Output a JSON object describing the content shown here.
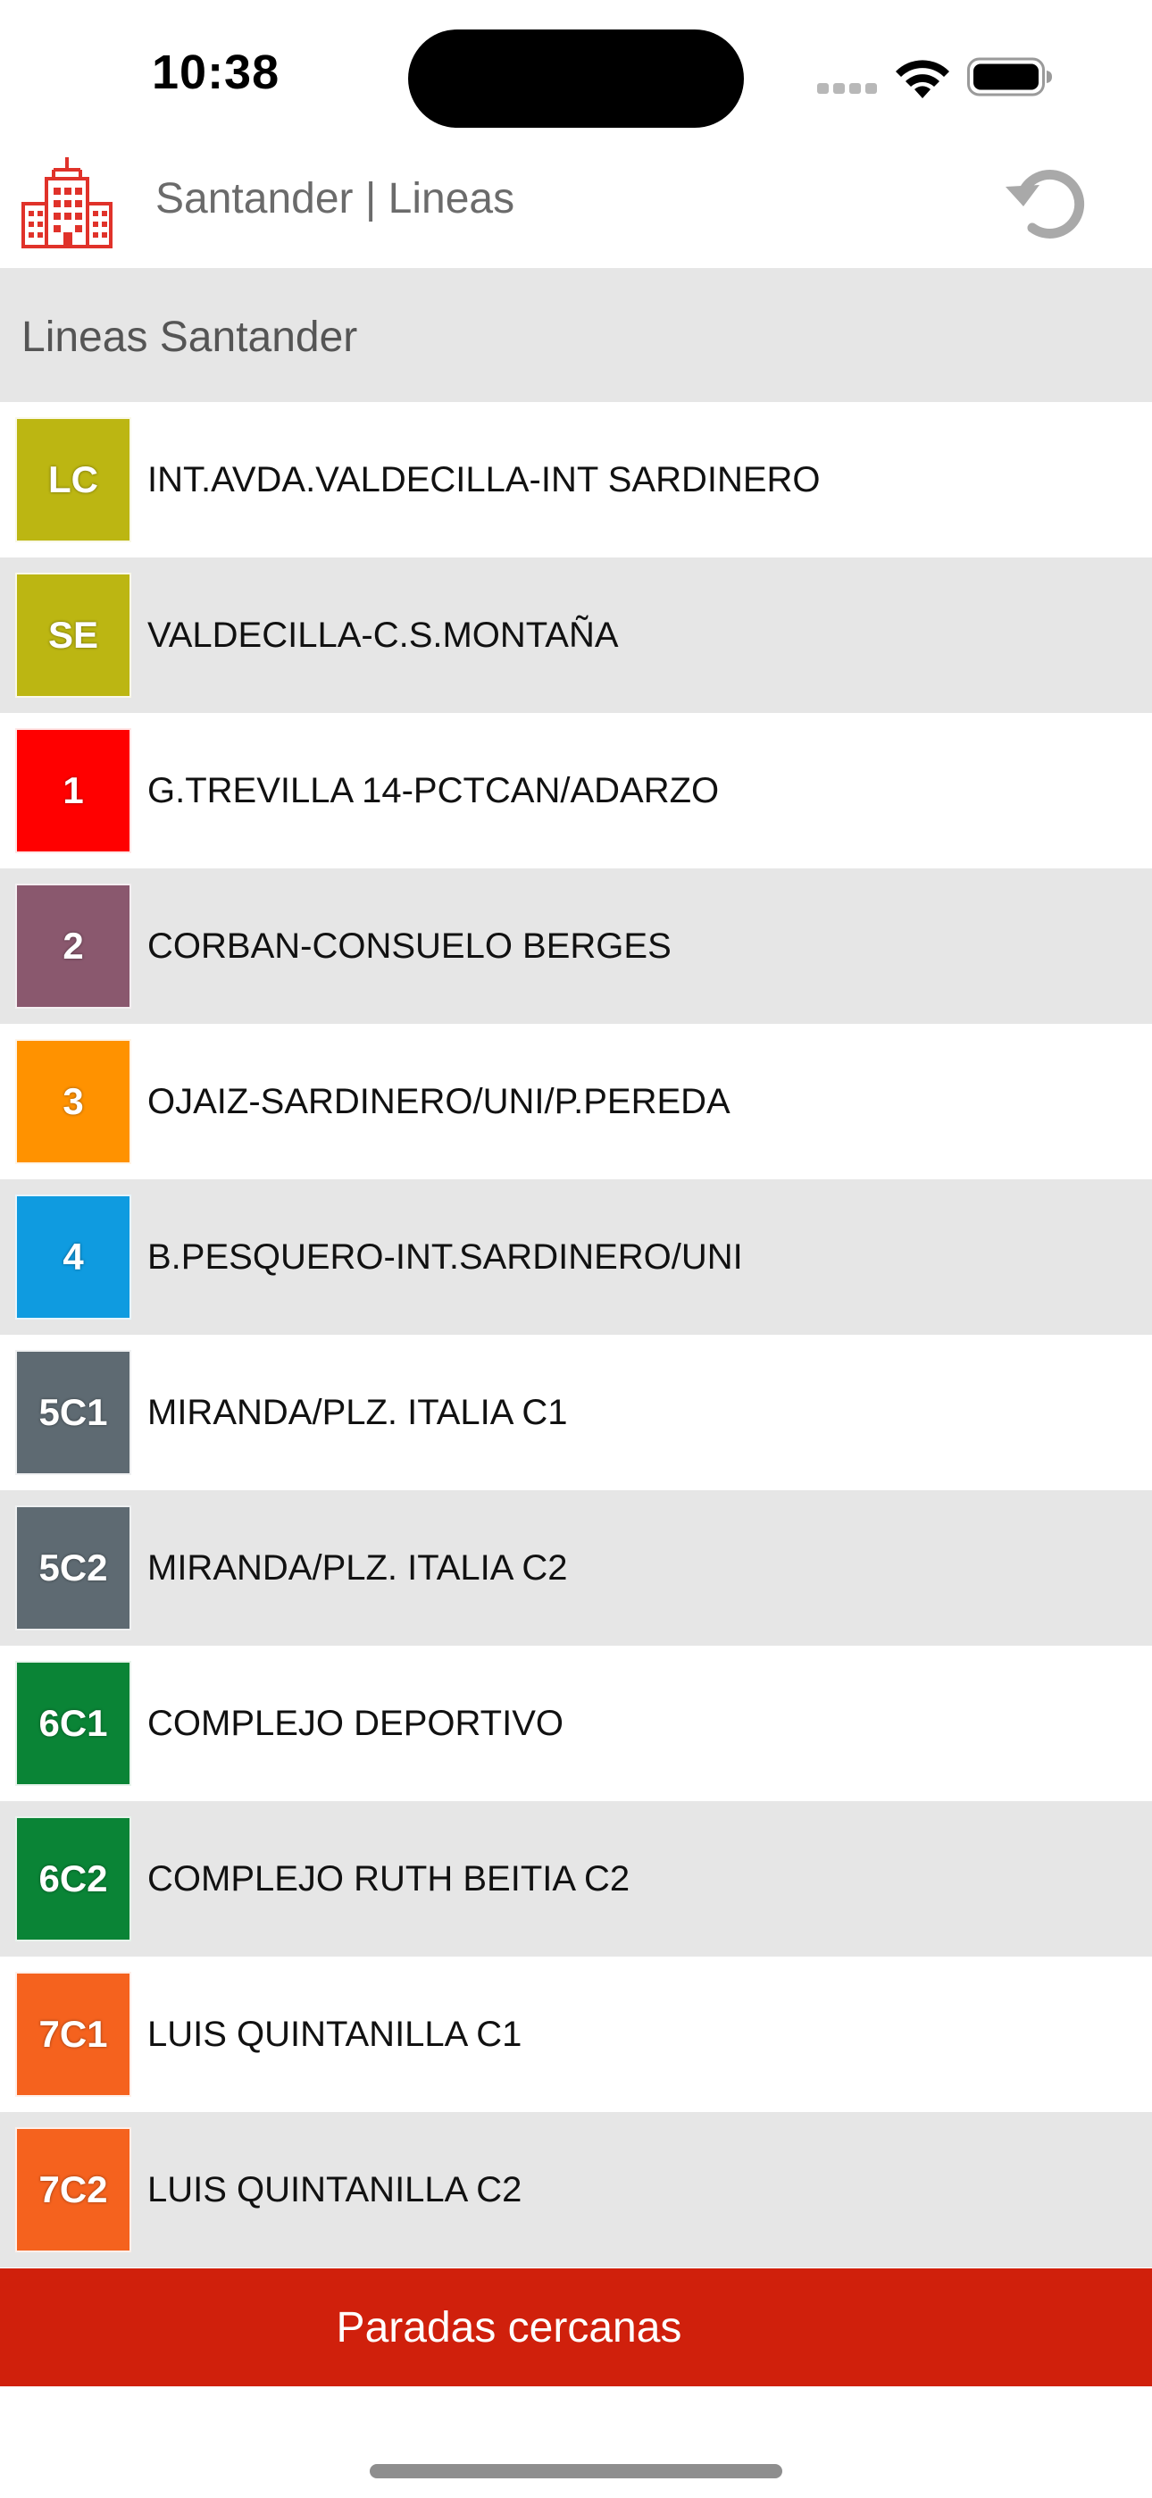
{
  "status_bar": {
    "time": "10:38",
    "icons": [
      "signal-dots-icon",
      "wifi-icon",
      "battery-icon"
    ]
  },
  "nav": {
    "logo_icon": "city-buildings-icon",
    "title": "Santander | Lineas",
    "refresh_icon": "refresh-icon",
    "logo_color": "#e0322a"
  },
  "section": {
    "title": "Lineas Santander"
  },
  "lines": [
    {
      "code": "LC",
      "name": "INT.AVDA.VALDECILLA-INT SARDINERO",
      "color": "#bcb612"
    },
    {
      "code": "SE",
      "name": "VALDECILLA-C.S.MONTAÑA",
      "color": "#bcb612"
    },
    {
      "code": "1",
      "name": "G.TREVILLA 14-PCTCAN/ADARZO",
      "color": "#ff0000"
    },
    {
      "code": "2",
      "name": "CORBAN-CONSUELO BERGES",
      "color": "#8a586e"
    },
    {
      "code": "3",
      "name": "OJAIZ-SARDINERO/UNI/P.PEREDA",
      "color": "#ff9200"
    },
    {
      "code": "4",
      "name": "B.PESQUERO-INT.SARDINERO/UNI",
      "color": "#0f9be0"
    },
    {
      "code": "5C1",
      "name": "MIRANDA/PLZ. ITALIA C1",
      "color": "#5e6a72"
    },
    {
      "code": "5C2",
      "name": "MIRANDA/PLZ. ITALIA C2",
      "color": "#5e6a72"
    },
    {
      "code": "6C1",
      "name": "COMPLEJO DEPORTIVO",
      "color": "#0a8436"
    },
    {
      "code": "6C2",
      "name": "COMPLEJO RUTH BEITIA C2",
      "color": "#0a8436"
    },
    {
      "code": "7C1",
      "name": "LUIS QUINTANILLA C1",
      "color": "#f5621e"
    },
    {
      "code": "7C2",
      "name": "LUIS QUINTANILLA C2",
      "color": "#f5621e"
    }
  ],
  "bottom": {
    "button_label": "Paradas cercanas",
    "button_color": "#d0200c"
  }
}
